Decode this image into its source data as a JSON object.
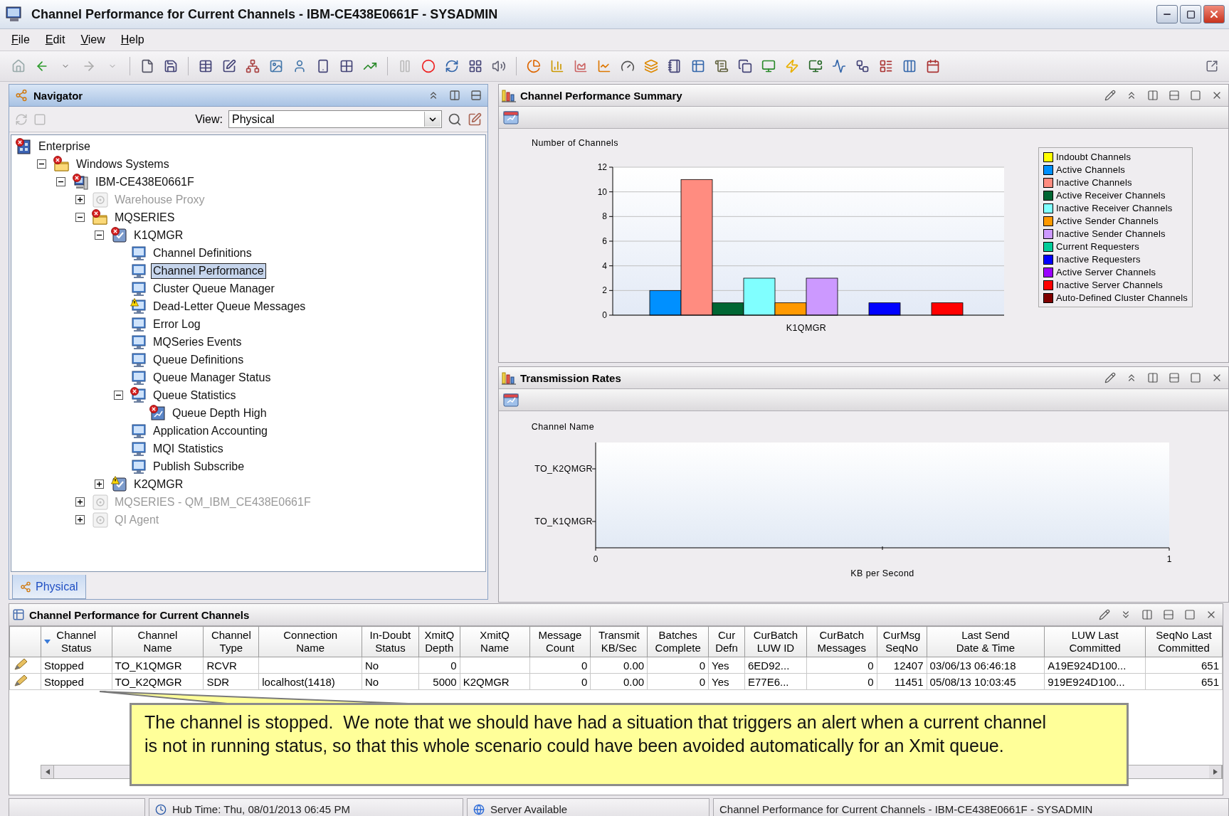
{
  "window": {
    "title": "Channel Performance for Current Channels - IBM-CE438E0661F - SYSADMIN"
  },
  "menu": [
    "File",
    "Edit",
    "View",
    "Help"
  ],
  "navigator": {
    "title": "Navigator",
    "view_label": "View:",
    "view_value": "Physical",
    "tree": [
      {
        "label": "Enterprise",
        "kind": "enterprise",
        "error": true,
        "warning": false,
        "selected": false,
        "disabled": false,
        "children": [
          {
            "label": "Windows Systems",
            "kind": "folder",
            "error": true,
            "warning": false,
            "expanded": true,
            "selected": false,
            "disabled": false,
            "children": [
              {
                "label": "IBM-CE438E0661F",
                "kind": "system",
                "error": true,
                "warning": false,
                "expanded": true,
                "selected": false,
                "disabled": false,
                "children": [
                  {
                    "label": "Warehouse Proxy",
                    "kind": "agent",
                    "error": false,
                    "warning": false,
                    "expanded": false,
                    "selected": false,
                    "disabled": true
                  },
                  {
                    "label": "MQSERIES",
                    "kind": "folder",
                    "error": true,
                    "warning": false,
                    "expanded": true,
                    "selected": false,
                    "disabled": false,
                    "children": [
                      {
                        "label": "K1QMGR",
                        "kind": "qmgr",
                        "error": true,
                        "warning": false,
                        "expanded": true,
                        "selected": false,
                        "disabled": false,
                        "children": [
                          {
                            "label": "Channel Definitions",
                            "kind": "monitor",
                            "error": false,
                            "warning": false,
                            "selected": false,
                            "disabled": false
                          },
                          {
                            "label": "Channel Performance",
                            "kind": "monitor",
                            "error": false,
                            "warning": false,
                            "selected": true,
                            "disabled": false
                          },
                          {
                            "label": "Cluster Queue Manager",
                            "kind": "monitor",
                            "error": false,
                            "warning": false,
                            "selected": false,
                            "disabled": false
                          },
                          {
                            "label": "Dead-Letter Queue Messages",
                            "kind": "monitor",
                            "error": false,
                            "warning": true,
                            "selected": false,
                            "disabled": false
                          },
                          {
                            "label": "Error Log",
                            "kind": "monitor",
                            "error": false,
                            "warning": false,
                            "selected": false,
                            "disabled": false
                          },
                          {
                            "label": "MQSeries Events",
                            "kind": "monitor",
                            "error": false,
                            "warning": false,
                            "selected": false,
                            "disabled": false
                          },
                          {
                            "label": "Queue Definitions",
                            "kind": "monitor",
                            "error": false,
                            "warning": false,
                            "selected": false,
                            "disabled": false
                          },
                          {
                            "label": "Queue Manager Status",
                            "kind": "monitor",
                            "error": false,
                            "warning": false,
                            "selected": false,
                            "disabled": false
                          },
                          {
                            "label": "Queue Statistics",
                            "kind": "monitor",
                            "error": true,
                            "warning": false,
                            "expanded": true,
                            "selected": false,
                            "disabled": false,
                            "children": [
                              {
                                "label": "Queue Depth High",
                                "kind": "situation",
                                "error": true,
                                "warning": false,
                                "selected": false,
                                "disabled": false
                              }
                            ]
                          },
                          {
                            "label": "Application Accounting",
                            "kind": "monitor",
                            "error": false,
                            "warning": false,
                            "selected": false,
                            "disabled": false
                          },
                          {
                            "label": "MQI Statistics",
                            "kind": "monitor",
                            "error": false,
                            "warning": false,
                            "selected": false,
                            "disabled": false
                          },
                          {
                            "label": "Publish Subscribe",
                            "kind": "monitor",
                            "error": false,
                            "warning": false,
                            "selected": false,
                            "disabled": false
                          }
                        ]
                      },
                      {
                        "label": "K2QMGR",
                        "kind": "qmgr",
                        "error": false,
                        "warning": true,
                        "expanded": false,
                        "selected": false,
                        "disabled": false
                      }
                    ]
                  },
                  {
                    "label": "MQSERIES - QM_IBM_CE438E0661F",
                    "kind": "agent",
                    "error": false,
                    "warning": false,
                    "expanded": false,
                    "selected": false,
                    "disabled": true
                  },
                  {
                    "label": "QI Agent",
                    "kind": "agent",
                    "error": false,
                    "warning": false,
                    "expanded": false,
                    "selected": false,
                    "disabled": true
                  }
                ]
              }
            ]
          }
        ]
      }
    ],
    "tabs": [
      {
        "label": "Physical",
        "selected": true
      }
    ]
  },
  "summary": {
    "title": "Channel Performance Summary",
    "chart_data": {
      "type": "bar",
      "ylabel": "Number of Channels",
      "categories": [
        "K1QMGR"
      ],
      "ylim": [
        0,
        12
      ],
      "yticks": [
        0,
        2,
        4,
        6,
        8,
        10,
        12
      ],
      "grid": true,
      "series": [
        {
          "name": "Indoubt Channels",
          "color": "#ffff00",
          "values": [
            0
          ]
        },
        {
          "name": "Active Channels",
          "color": "#0090ff",
          "values": [
            2
          ]
        },
        {
          "name": "Inactive Channels",
          "color": "#ff8c80",
          "values": [
            11
          ]
        },
        {
          "name": "Active Receiver Channels",
          "color": "#006633",
          "values": [
            1
          ]
        },
        {
          "name": "Inactive Receiver Channels",
          "color": "#80ffff",
          "values": [
            3
          ]
        },
        {
          "name": "Active Sender Channels",
          "color": "#ff9900",
          "values": [
            1
          ]
        },
        {
          "name": "Inactive Sender Channels",
          "color": "#cc99ff",
          "values": [
            3
          ]
        },
        {
          "name": "Current Requesters",
          "color": "#00cc99",
          "values": [
            0
          ]
        },
        {
          "name": "Inactive Requesters",
          "color": "#0000ff",
          "values": [
            1
          ]
        },
        {
          "name": "Active Server Channels",
          "color": "#9900ff",
          "values": [
            0
          ]
        },
        {
          "name": "Inactive Server Channels",
          "color": "#ff0000",
          "values": [
            1
          ]
        },
        {
          "name": "Auto-Defined Cluster Channels",
          "color": "#800000",
          "values": [
            0
          ]
        }
      ]
    }
  },
  "transmission": {
    "title": "Transmission Rates",
    "chart_data": {
      "type": "bar",
      "orientation": "horizontal",
      "ylabel": "Channel Name",
      "xlabel": "KB per Second",
      "categories": [
        "TO_K2QMGR",
        "TO_K1QMGR"
      ],
      "xlim": [
        0,
        1
      ],
      "xticks": [
        0,
        1
      ],
      "series": [
        {
          "values": [
            0,
            0
          ]
        }
      ]
    }
  },
  "table": {
    "title": "Channel Performance for Current Channels",
    "columns": [
      {
        "label": "Channel\nStatus",
        "kind": "text",
        "sorted": true
      },
      {
        "label": "Channel\nName",
        "kind": "text",
        "sorted": false
      },
      {
        "label": "Channel\nType",
        "kind": "text",
        "sorted": false
      },
      {
        "label": "Connection\nName",
        "kind": "text",
        "sorted": false
      },
      {
        "label": "In-Doubt\nStatus",
        "kind": "text",
        "sorted": false
      },
      {
        "label": "XmitQ\nDepth",
        "kind": "number",
        "sorted": false
      },
      {
        "label": "XmitQ\nName",
        "kind": "text",
        "sorted": false
      },
      {
        "label": "Message\nCount",
        "kind": "number",
        "sorted": false
      },
      {
        "label": "Transmit\nKB/Sec",
        "kind": "number",
        "sorted": false
      },
      {
        "label": "Batches\nComplete",
        "kind": "number",
        "sorted": false
      },
      {
        "label": "Cur\nDefn",
        "kind": "text",
        "sorted": false
      },
      {
        "label": "CurBatch\nLUW ID",
        "kind": "text",
        "sorted": false
      },
      {
        "label": "CurBatch\nMessages",
        "kind": "number",
        "sorted": false
      },
      {
        "label": "CurMsg\nSeqNo",
        "kind": "number",
        "sorted": false
      },
      {
        "label": "Last Send\nDate & Time",
        "kind": "text",
        "sorted": false
      },
      {
        "label": "LUW Last\nCommitted",
        "kind": "text",
        "sorted": false
      },
      {
        "label": "SeqNo Last\nCommitted",
        "kind": "number",
        "sorted": false
      }
    ],
    "rows": [
      {
        "cells": [
          "Stopped",
          "TO_K1QMGR",
          "RCVR",
          null,
          "No",
          "0",
          null,
          "0",
          "0.00",
          "0",
          "Yes",
          "6ED92...",
          "0",
          "12407",
          "03/06/13 06:46:18",
          "A19E924D100...",
          "651"
        ]
      },
      {
        "cells": [
          "Stopped",
          "TO_K2QMGR",
          "SDR",
          "localhost(1418)",
          "No",
          "5000",
          "K2QMGR",
          "0",
          "0.00",
          "0",
          "Yes",
          "E77E6...",
          "0",
          "11451",
          "05/08/13 10:03:45",
          "919E924D100...",
          "651"
        ]
      }
    ]
  },
  "callout": {
    "text": "The channel is stopped.  We note that we should have had a situation that triggers an alert when a current channel is not in running status, so that this whole scenario could have been avoided automatically for an Xmit queue."
  },
  "status_bar": [
    {
      "kind": "clock",
      "text": "Hub Time: Thu, 08/01/2013 06:45 PM"
    },
    {
      "kind": "globe",
      "text": "Server Available"
    },
    {
      "kind": "plain",
      "text": "Channel Performance for Current Channels - IBM-CE438E0661F - SYSADMIN"
    }
  ]
}
